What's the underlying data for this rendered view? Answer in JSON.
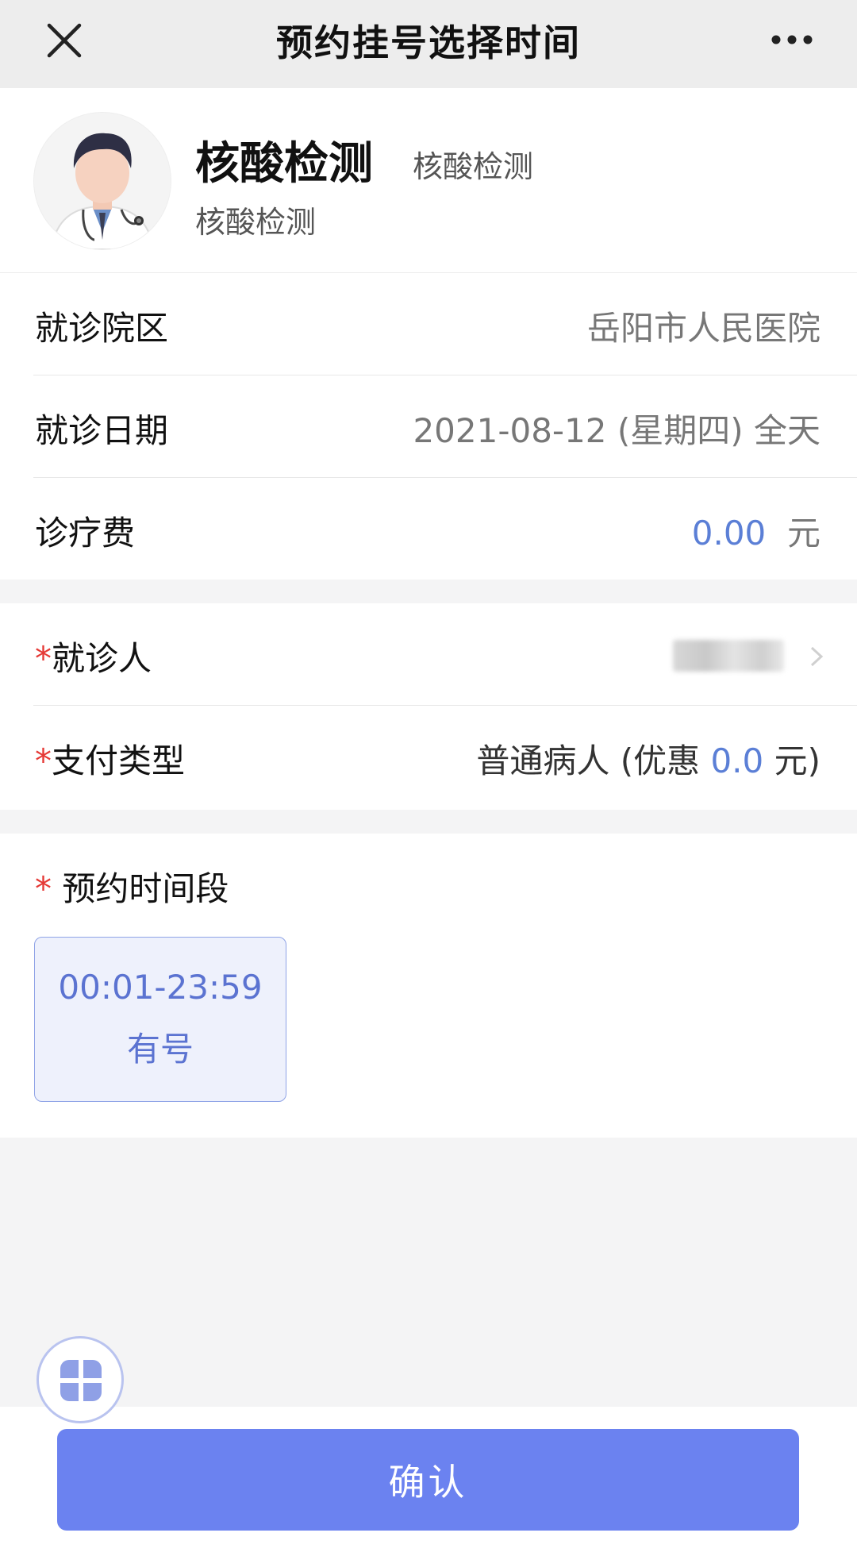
{
  "header": {
    "title": "预约挂号选择时间",
    "close_icon": "close-icon",
    "more_icon": "more-icon"
  },
  "doctor": {
    "name": "核酸检测",
    "tag": "核酸检测",
    "department": "核酸检测",
    "avatar_icon": "doctor-avatar"
  },
  "info": {
    "campus_label": "就诊院区",
    "campus_value": "岳阳市人民医院",
    "date_label": "就诊日期",
    "date_value": "2021-08-12 (星期四) 全天",
    "fee_label": "诊疗费",
    "fee_amount": "0.00",
    "fee_unit": "元"
  },
  "patient": {
    "required_mark": "*",
    "patient_label": "就诊人",
    "payment_label": "支付类型",
    "payment_prefix": "普通病人 (优惠 ",
    "payment_discount": "0.0",
    "payment_suffix": " 元)"
  },
  "timeslot": {
    "required_mark": "*",
    "label": " 预约时间段",
    "slots": [
      {
        "time": "00:01-23:59",
        "status": "有号"
      }
    ]
  },
  "footer": {
    "confirm_label": "确认",
    "fab_icon": "grid-menu-icon"
  },
  "colors": {
    "accent": "#6b82f0",
    "link_blue": "#5b7fd6",
    "required": "#e53935"
  }
}
